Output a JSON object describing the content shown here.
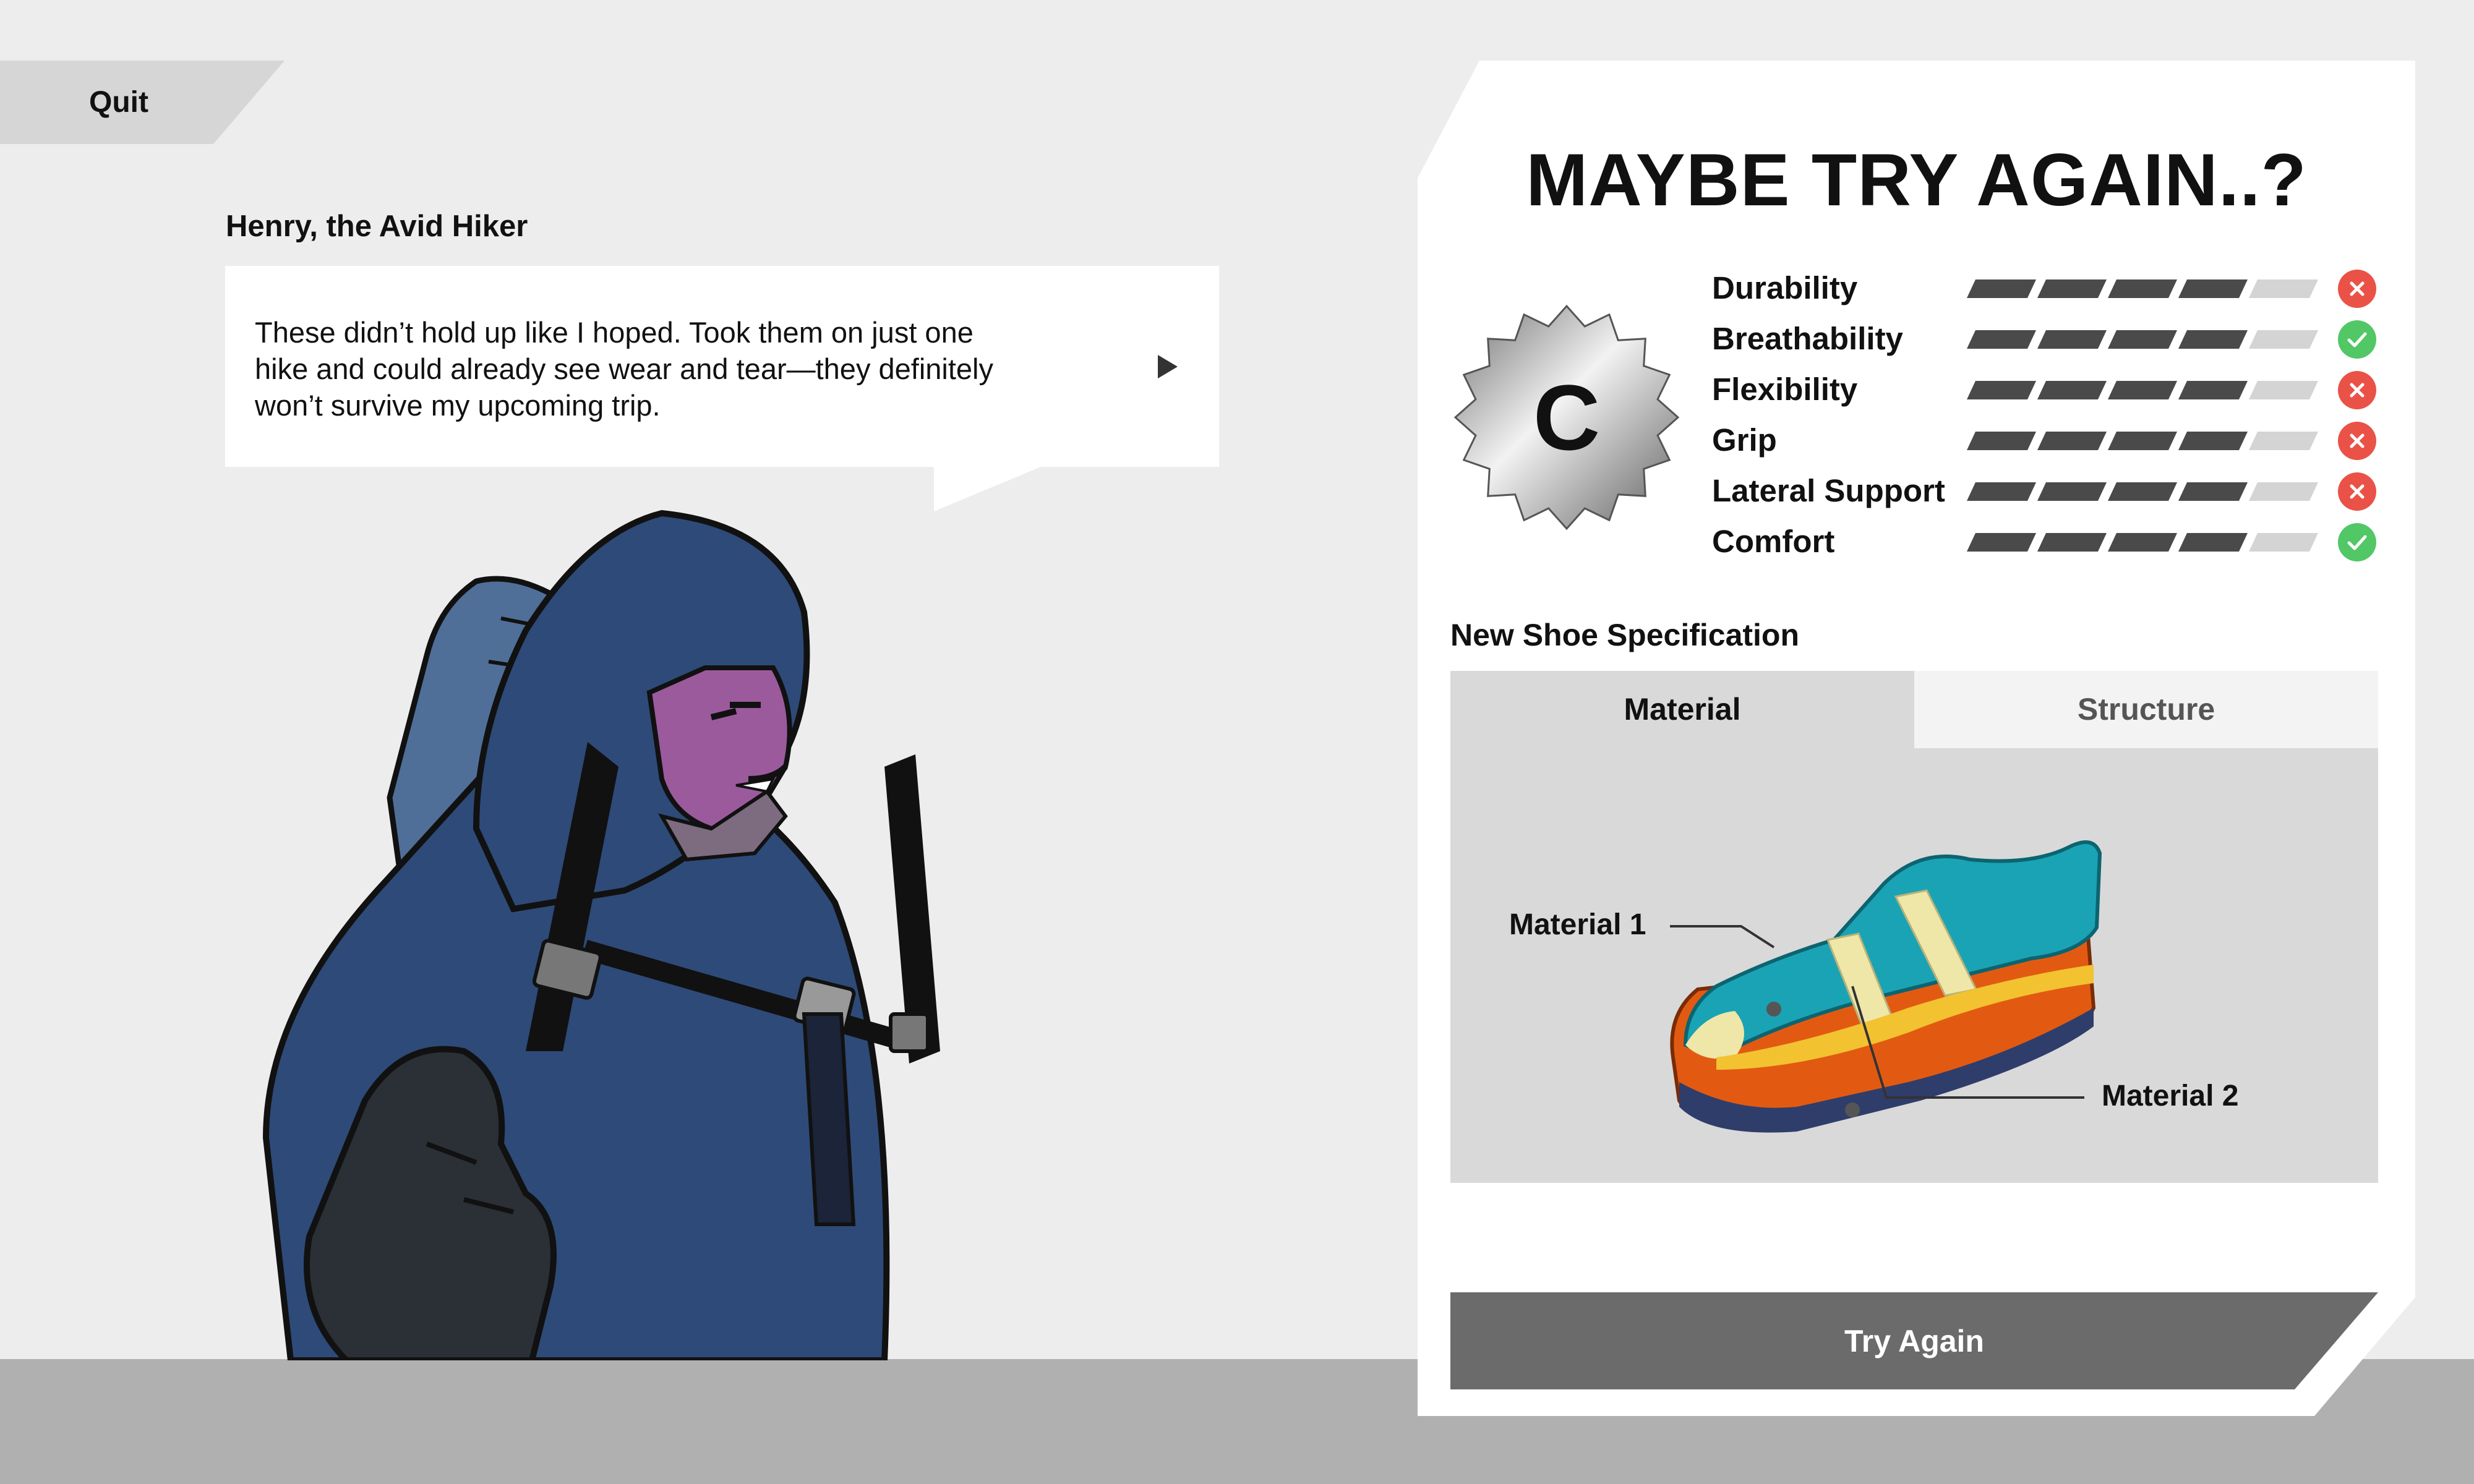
{
  "quit_label": "Quit",
  "speaker": "Henry, the Avid Hiker",
  "dialogue": {
    "line1": "These didn’t hold up like I hoped. Took them on just one",
    "line2": "hike and could already see wear and tear—they definitely",
    "line3": "won’t survive my upcoming trip."
  },
  "result_title": "MAYBE TRY AGAIN..?",
  "grade": "C",
  "stats": [
    {
      "label": "Durability",
      "level": 0.8,
      "status": "fail",
      "icon": "cross-icon"
    },
    {
      "label": "Breathability",
      "level": 0.8,
      "status": "pass",
      "icon": "check-icon"
    },
    {
      "label": "Flexibility",
      "level": 0.8,
      "status": "fail",
      "icon": "cross-icon"
    },
    {
      "label": "Grip",
      "level": 0.8,
      "status": "fail",
      "icon": "cross-icon"
    },
    {
      "label": "Lateral Support",
      "level": 0.8,
      "status": "fail",
      "icon": "cross-icon"
    },
    {
      "label": "Comfort",
      "level": 0.8,
      "status": "pass",
      "icon": "check-icon"
    }
  ],
  "spec_title": "New Shoe Specification",
  "tabs": {
    "material": "Material",
    "structure": "Structure"
  },
  "materials": {
    "m1": "Material 1",
    "m2": "Material 2"
  },
  "try_again_label": "Try Again",
  "colors": {
    "fail": "#ea5247",
    "pass": "#52c766",
    "bar_dark": "#4a4a4a",
    "bar_light": "#d4d4d4",
    "hoodie": "#2e4a78"
  }
}
